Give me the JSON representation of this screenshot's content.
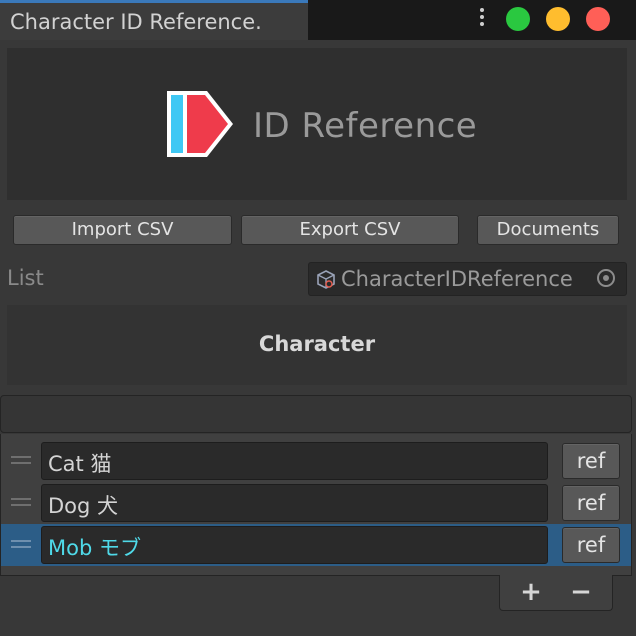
{
  "window": {
    "tab_title": "Character ID Reference."
  },
  "logo": {
    "text": "ID Reference",
    "colors": {
      "left_bar": "#3fc8f4",
      "arrow": "#ef3b4b",
      "outline": "#ffffff"
    }
  },
  "toolbar": {
    "import_label": "Import CSV",
    "export_label": "Export CSV",
    "documents_label": "Documents"
  },
  "list_field": {
    "label": "List",
    "value": "CharacterIDReference",
    "icon": "scriptable-object-icon"
  },
  "header": {
    "title": "Character"
  },
  "items": [
    {
      "name": "Cat 猫",
      "ref_label": "ref",
      "selected": false
    },
    {
      "name": "Dog 犬",
      "ref_label": "ref",
      "selected": false
    },
    {
      "name": "Mob モブ",
      "ref_label": "ref",
      "selected": true
    }
  ],
  "footer": {
    "add_label": "+",
    "remove_label": "−"
  },
  "colors": {
    "selection": "#2c5d87",
    "selected_text": "#4fd9e8",
    "tab_accent": "#3a79bb"
  }
}
